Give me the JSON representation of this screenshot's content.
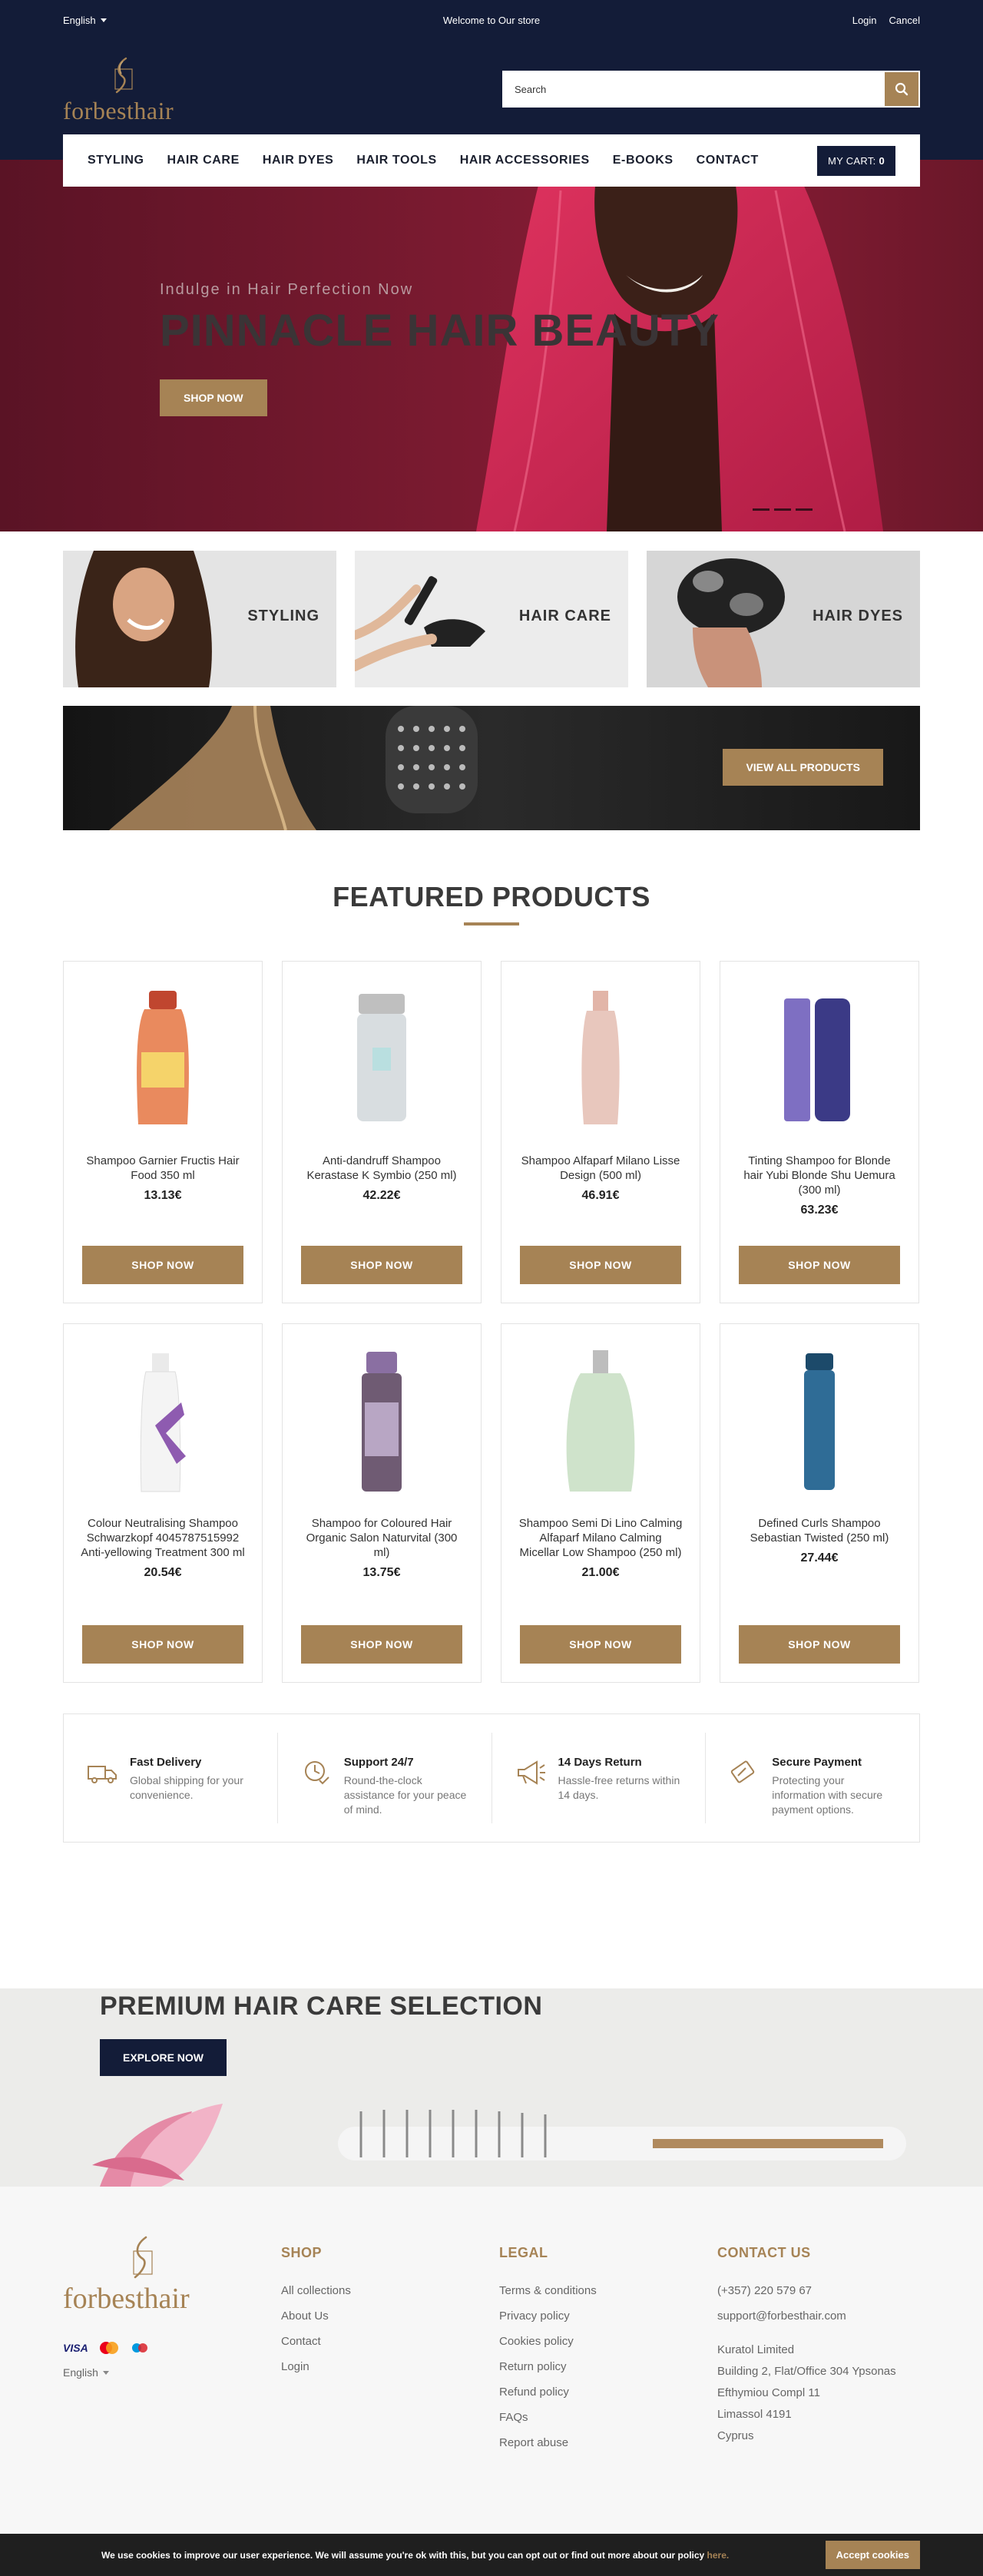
{
  "topbar": {
    "language": "English",
    "welcome": "Welcome to Our store",
    "login": "Login",
    "cancel": "Cancel"
  },
  "header": {
    "logo_text": "forbesthair",
    "search_placeholder": "Search"
  },
  "nav": {
    "items": [
      "STYLING",
      "HAIR CARE",
      "HAIR DYES",
      "HAIR TOOLS",
      "HAIR ACCESSORIES",
      "E-BOOKS",
      "CONTACT"
    ],
    "cart_label": "MY CART:",
    "cart_count": "0"
  },
  "hero": {
    "kicker": "Indulge in Hair Perfection Now",
    "title": "PINNACLE HAIR BEAUTY",
    "button": "SHOP NOW"
  },
  "categories": [
    {
      "label": "STYLING"
    },
    {
      "label": "HAIR CARE"
    },
    {
      "label": "HAIR DYES"
    }
  ],
  "banner": {
    "button": "VIEW ALL PRODUCTS"
  },
  "featured": {
    "title": "FEATURED PRODUCTS",
    "button": "SHOP NOW",
    "products": [
      {
        "name": "Shampoo Garnier Fructis Hair Food 350 ml",
        "price": "13.13€",
        "color": "#e98a5e"
      },
      {
        "name": "Anti-dandruff Shampoo Kerastase K Symbio (250 ml)",
        "price": "42.22€",
        "color": "#d8dde0"
      },
      {
        "name": "Shampoo Alfaparf Milano Lisse Design (500 ml)",
        "price": "46.91€",
        "color": "#e8c7bd"
      },
      {
        "name": "Tinting Shampoo for Blonde hair Yubi Blonde Shu Uemura (300 ml)",
        "price": "63.23€",
        "color": "#3b3a86"
      },
      {
        "name": "Colour Neutralising Shampoo Schwarzkopf 4045787515992 Anti-yellowing Treatment 300 ml",
        "price": "20.54€",
        "color": "#8e5bb0"
      },
      {
        "name": "Shampoo for Coloured Hair Organic Salon Naturvital (300 ml)",
        "price": "13.75€",
        "color": "#6f5b73"
      },
      {
        "name": "Shampoo Semi Di Lino Calming Alfaparf Milano Calming Micellar Low Shampoo (250 ml)",
        "price": "21.00€",
        "color": "#cfe3cb"
      },
      {
        "name": "Defined Curls Shampoo Sebastian Twisted (250 ml)",
        "price": "27.44€",
        "color": "#2f6c96"
      }
    ]
  },
  "features": [
    {
      "title": "Fast Delivery",
      "text": "Global shipping for your convenience.",
      "icon": "truck-icon"
    },
    {
      "title": "Support 24/7",
      "text": "Round-the-clock assistance for your peace of mind.",
      "icon": "clock-check-icon"
    },
    {
      "title": "14 Days Return",
      "text": "Hassle-free returns within 14 days.",
      "icon": "megaphone-icon"
    },
    {
      "title": "Secure Payment",
      "text": "Protecting your information with secure payment options.",
      "icon": "secure-card-icon"
    }
  ],
  "premium": {
    "title": "PREMIUM HAIR CARE SELECTION",
    "button": "EXPLORE NOW"
  },
  "footer": {
    "logo_text": "forbesthair",
    "language": "English",
    "shop": {
      "title": "SHOP",
      "items": [
        "All collections",
        "About Us",
        "Contact",
        "Login"
      ]
    },
    "legal": {
      "title": "LEGAL",
      "items": [
        "Terms & conditions",
        "Privacy policy",
        "Cookies policy",
        "Return policy",
        "Refund policy",
        "FAQs",
        "Report abuse"
      ]
    },
    "contact": {
      "title": "CONTACT US",
      "phone": "(+357) 220 579 67",
      "email": "support@forbesthair.com",
      "address": [
        "Kuratol Limited",
        "Building 2, Flat/Office 304 Ypsonas",
        "Efthymiou Compl 11",
        "Limassol 4191",
        "Cyprus"
      ]
    },
    "payments": [
      "VISA",
      "mastercard",
      "maestro"
    ]
  },
  "cookie": {
    "message": "We use cookies to improve our user experience. We will assume you're ok with this, but you can opt out or find out more about our policy ",
    "link": "here.",
    "button": "Accept cookies"
  },
  "colors": {
    "navy": "#131c38",
    "gold": "#a68355",
    "hero": "#7a1a30"
  }
}
